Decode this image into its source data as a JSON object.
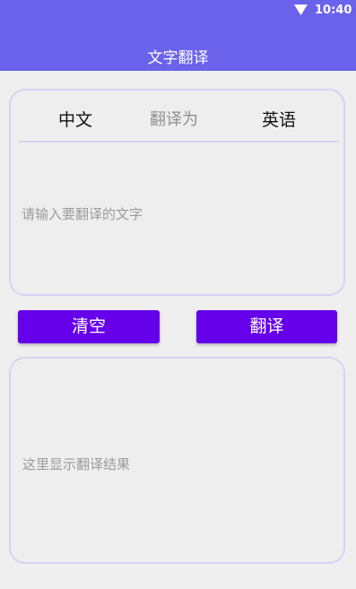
{
  "status_bar": {
    "time": "10:40",
    "wifi_icon": "wifi-icon"
  },
  "header": {
    "title": "文字翻译",
    "background": "#6a62ea"
  },
  "translator": {
    "source_language": "中文",
    "direction_label": "翻译为",
    "target_language": "英语",
    "input_placeholder": "请输入要翻译的文字",
    "input_value": ""
  },
  "actions": {
    "clear_label": "清空",
    "translate_label": "翻译",
    "button_color": "#6600ea"
  },
  "result": {
    "placeholder_text": "这里显示翻译结果"
  }
}
